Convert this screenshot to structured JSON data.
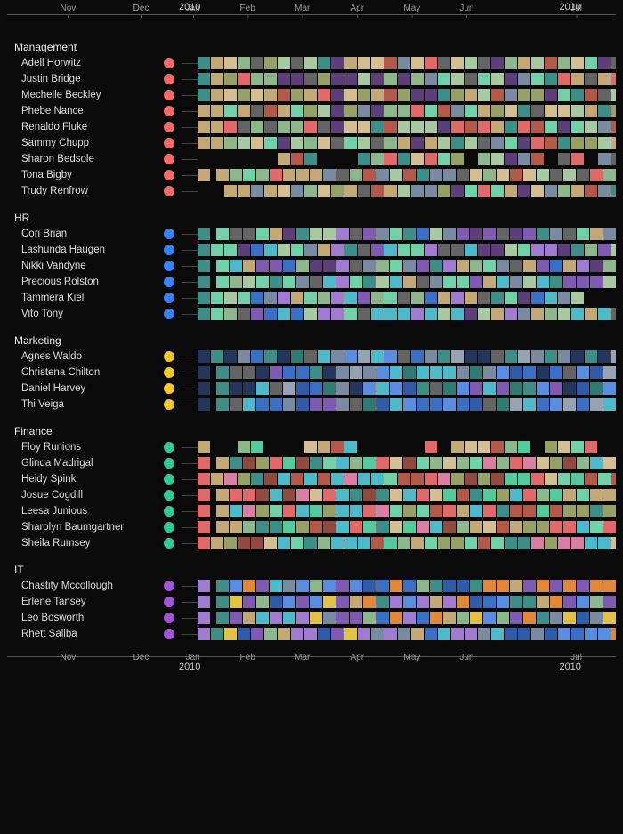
{
  "chart_data": {
    "type": "heatmap",
    "title": "",
    "timeline": {
      "months": [
        "Nov",
        "Dec",
        "Jan",
        "Feb",
        "Mar",
        "Apr",
        "May",
        "Jun",
        "Jul"
      ],
      "year_markers": [
        "2010",
        "2010"
      ],
      "month_tick_positions_pct": [
        10,
        22,
        30.5,
        39.5,
        48.5,
        57.5,
        66.5,
        75.5,
        93.5
      ],
      "year_tick_positions_pct": [
        30,
        92.5
      ]
    },
    "legend_colors": {
      "Management": "#f46d6a",
      "HR": "#3b82f6",
      "Marketing": "#f5c72b",
      "Finance": "#34c79a",
      "IT": "#a056d6"
    },
    "palette": {
      "sage": "#8fb78d",
      "sage2": "#a8c9a2",
      "teal": "#3f8d87",
      "teal2": "#2f7b74",
      "mint": "#72d1a8",
      "mint2": "#55c89c",
      "blue": "#3b6fc4",
      "blue2": "#2f5ba8",
      "blue3": "#5a8de0",
      "navy": "#24365c",
      "slate": "#7a8aa0",
      "slate2": "#97a3b5",
      "purple": "#7e5ab0",
      "purple2": "#a07cd0",
      "plum": "#5c3f78",
      "pink": "#d97fa3",
      "rose": "#e06a6a",
      "rust": "#b25a4a",
      "brick": "#8f4b3f",
      "tan": "#c3a878",
      "tan2": "#d4bf95",
      "olive": "#97a066",
      "gray": "#636363",
      "gray2": "#888",
      "dark": "#1a1a1a",
      "black": "#0d0d0d",
      "gold": "#e0c24a",
      "orange": "#e0893a",
      "aqua": "#4fb8c9"
    },
    "groups": [
      {
        "name": "Management",
        "color_key": "Management",
        "rows": [
          {
            "name": "Adell Horwitz",
            "seed": 11,
            "lead_blank": 0,
            "gaps": []
          },
          {
            "name": "Justin Bridge",
            "seed": 22,
            "lead_blank": 0,
            "gaps": []
          },
          {
            "name": "Mechelle Beckley",
            "seed": 33,
            "lead_blank": 0,
            "gaps": []
          },
          {
            "name": "Phebe Nance",
            "seed": 44,
            "lead_blank": 0,
            "gaps": []
          },
          {
            "name": "Renaldo Fluke",
            "seed": 55,
            "lead_blank": 0,
            "gaps": []
          },
          {
            "name": "Sammy Chupp",
            "seed": 66,
            "lead_blank": 0,
            "gaps": []
          },
          {
            "name": "Sharon Bedsole",
            "seed": 77,
            "lead_blank": 6,
            "gaps": [
              [
                9,
                3
              ]
            ],
            "sparse": true
          },
          {
            "name": "Tona Bigby",
            "seed": 88,
            "lead_blank": 0,
            "pre": true,
            "gaps": []
          },
          {
            "name": "Trudy Renfrow",
            "seed": 99,
            "lead_blank": 2,
            "gaps": []
          }
        ]
      },
      {
        "name": "HR",
        "color_key": "HR",
        "rows": [
          {
            "name": "Cori Brian",
            "seed": 111,
            "lead_blank": 0,
            "pre": true,
            "gaps": []
          },
          {
            "name": "Lashunda Haugen",
            "seed": 122,
            "lead_blank": 0,
            "gaps": []
          },
          {
            "name": "Nikki Vandyne",
            "seed": 133,
            "lead_blank": 0,
            "pre": true,
            "gaps": []
          },
          {
            "name": "Precious Rolston",
            "seed": 144,
            "lead_blank": 0,
            "pre": true,
            "gaps": []
          },
          {
            "name": "Tammera Kiel",
            "seed": 155,
            "lead_blank": 0,
            "short": 3,
            "gaps": []
          },
          {
            "name": "Vito Tony",
            "seed": 166,
            "lead_blank": 0,
            "gaps": []
          }
        ]
      },
      {
        "name": "Marketing",
        "color_key": "Marketing",
        "rows": [
          {
            "name": "Agnes Waldo",
            "seed": 211,
            "lead_blank": 0,
            "gaps": []
          },
          {
            "name": "Christena Chilton",
            "seed": 222,
            "lead_blank": 0,
            "pre": true,
            "gaps": []
          },
          {
            "name": "Daniel Harvey",
            "seed": 233,
            "lead_blank": 0,
            "pre": true,
            "gaps": []
          },
          {
            "name": "Thi Veiga",
            "seed": 244,
            "lead_blank": 0,
            "pre": true,
            "gaps": []
          }
        ]
      },
      {
        "name": "Finance",
        "color_key": "Finance",
        "rows": [
          {
            "name": "Floy Runions",
            "seed": 311,
            "lead_blank": 0,
            "sparse": true,
            "gaps": [
              [
                1,
                2
              ],
              [
                5,
                3
              ],
              [
                12,
                4
              ]
            ]
          },
          {
            "name": "Glinda Madrigal",
            "seed": 322,
            "lead_blank": 0,
            "pre": true,
            "gaps": []
          },
          {
            "name": "Heidy Spink",
            "seed": 333,
            "lead_blank": 0,
            "gaps": []
          },
          {
            "name": "Josue Cogdill",
            "seed": 344,
            "lead_blank": 0,
            "pre": true,
            "gaps": []
          },
          {
            "name": "Leesa Junious",
            "seed": 355,
            "lead_blank": 0,
            "pre": true,
            "gaps": []
          },
          {
            "name": "Sharolyn Baumgartner",
            "seed": 366,
            "lead_blank": 0,
            "pre": true,
            "gaps": []
          },
          {
            "name": "Sheila Rumsey",
            "seed": 377,
            "lead_blank": 0,
            "gaps": []
          }
        ]
      },
      {
        "name": "IT",
        "color_key": "IT",
        "rows": [
          {
            "name": "Chastity Mccollough",
            "seed": 411,
            "lead_blank": 0,
            "pre": true,
            "gaps": []
          },
          {
            "name": "Erlene Tansey",
            "seed": 422,
            "lead_blank": 0,
            "pre": true,
            "gaps": []
          },
          {
            "name": "Leo Bosworth",
            "seed": 433,
            "lead_blank": 0,
            "pre": true,
            "gaps": []
          },
          {
            "name": "Rhett Saliba",
            "seed": 444,
            "lead_blank": 0,
            "gaps": []
          }
        ]
      }
    ],
    "cells_per_row": 32
  }
}
